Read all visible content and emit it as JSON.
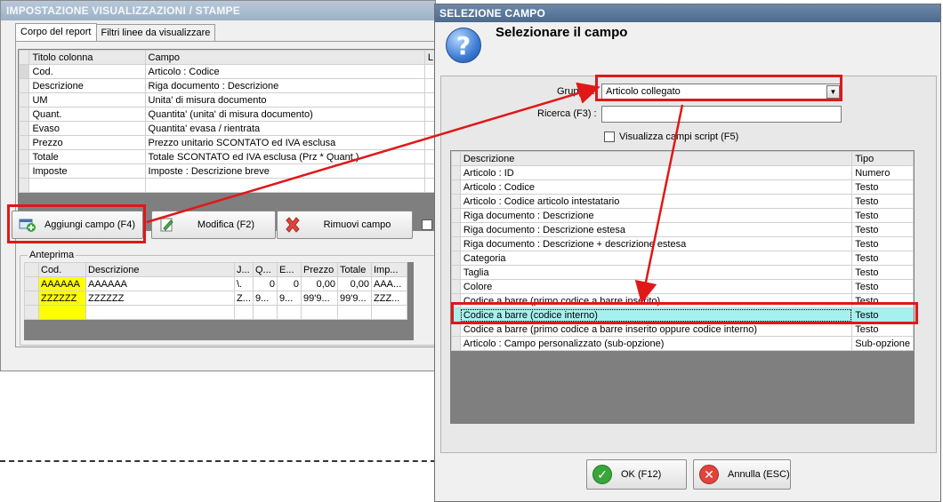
{
  "left_window": {
    "title": "IMPOSTAZIONE VISUALIZZAZIONI / STAMPE",
    "tabs": [
      {
        "label": "Corpo del report"
      },
      {
        "label": "Filtri linee da visualizzare"
      }
    ],
    "columns_grid": {
      "headers": [
        "Titolo colonna",
        "Campo",
        "L"
      ],
      "rows": [
        {
          "title": "Cod.",
          "field": "Articolo : Codice"
        },
        {
          "title": "Descrizione",
          "field": "Riga documento : Descrizione"
        },
        {
          "title": "UM",
          "field": "Unita' di misura documento"
        },
        {
          "title": "Quant.",
          "field": "Quantita' (unita' di misura documento)"
        },
        {
          "title": "Evaso",
          "field": "Quantita' evasa / rientrata"
        },
        {
          "title": "Prezzo",
          "field": "Prezzo unitario SCONTATO ed IVA esclusa"
        },
        {
          "title": "Totale",
          "field": "Totale SCONTATO ed IVA esclusa (Prz * Quant.)"
        },
        {
          "title": "Imposte",
          "field": "Imposte : Descrizione breve"
        }
      ]
    },
    "buttons": {
      "add": "Aggiungi campo (F4)",
      "edit": "Modifica (F2)",
      "remove": "Rimuovi campo"
    },
    "preview": {
      "legend": "Anteprima",
      "headers": [
        "Cod.",
        "Descrizione",
        "J...",
        "Q...",
        "E...",
        "Prezzo",
        "Totale",
        "Imp..."
      ],
      "rows": [
        [
          "AAAAAA",
          "AAAAAA",
          "\\.",
          "0",
          "0",
          "0,00",
          "0,00",
          "AAA..."
        ],
        [
          "ZZZZZZ",
          "ZZZZZZ",
          "Z...",
          "9...",
          "9...",
          "99'9...",
          "99'9...",
          "ZZZ..."
        ]
      ]
    }
  },
  "dialog": {
    "title": "SELEZIONE CAMPO",
    "heading": "Selezionare il campo",
    "group_label": "Gruppo :",
    "group_value": "Articolo collegato",
    "search_label": "Ricerca (F3) :",
    "search_value": "",
    "script_checkbox_label": "Visualizza campi script (F5)",
    "table": {
      "headers": [
        "Descrizione",
        "Tipo"
      ],
      "rows": [
        {
          "desc": "Articolo : ID",
          "type": "Numero"
        },
        {
          "desc": "Articolo : Codice",
          "type": "Testo"
        },
        {
          "desc": "Articolo : Codice articolo intestatario",
          "type": "Testo"
        },
        {
          "desc": "Riga documento : Descrizione",
          "type": "Testo"
        },
        {
          "desc": "Riga documento : Descrizione estesa",
          "type": "Testo"
        },
        {
          "desc": "Riga documento : Descrizione + descrizione estesa",
          "type": "Testo"
        },
        {
          "desc": "Categoria",
          "type": "Testo"
        },
        {
          "desc": "Taglia",
          "type": "Testo"
        },
        {
          "desc": "Colore",
          "type": "Testo"
        },
        {
          "desc": "Codice a barre (primo codice a barre inserito)",
          "type": "Testo"
        },
        {
          "desc": "Codice a barre (codice interno)",
          "type": "Testo"
        },
        {
          "desc": "Codice a barre (primo codice a barre inserito oppure codice interno)",
          "type": "Testo"
        },
        {
          "desc": "Articolo : Campo personalizzato (sub-opzione)",
          "type": "Sub-opzione"
        }
      ]
    },
    "ok_label": "OK (F12)",
    "cancel_label": "Annulla (ESC)"
  },
  "colors": {
    "annotation_red": "#e01818",
    "selected_row": "#a6f0f0",
    "preview_code_cell": "#ffff00"
  }
}
